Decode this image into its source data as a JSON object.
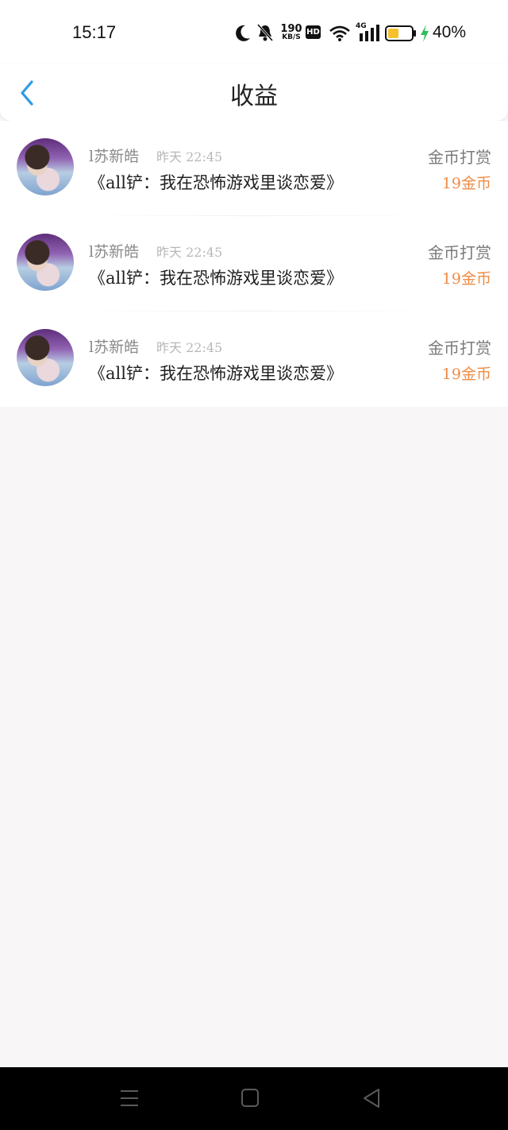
{
  "status_bar": {
    "time": "15:17",
    "network_speed_top": "190",
    "network_speed_bottom": "KB/S",
    "hd_label": "HD",
    "signal_label": "4G",
    "battery_percent": "40%",
    "icons": [
      "moon-icon",
      "bell-off-icon",
      "hd-icon",
      "wifi-icon",
      "signal-icon",
      "battery-icon",
      "charging-icon"
    ]
  },
  "header": {
    "title": "收益",
    "back_icon": "chevron-left-icon",
    "accent_color": "#2e9be6"
  },
  "entries": [
    {
      "name": "l苏新皓",
      "date": "昨天 22:45",
      "book": "《all铲：我在恐怖游戏里谈恋爱》",
      "type": "金币打赏",
      "amount_num": "19",
      "amount_unit": "金币"
    },
    {
      "name": "l苏新皓",
      "date": "昨天 22:45",
      "book": "《all铲：我在恐怖游戏里谈恋爱》",
      "type": "金币打赏",
      "amount_num": "19",
      "amount_unit": "金币"
    },
    {
      "name": "l苏新皓",
      "date": "昨天 22:45",
      "book": "《all铲：我在恐怖游戏里谈恋爱》",
      "type": "金币打赏",
      "amount_num": "19",
      "amount_unit": "金币"
    }
  ],
  "colors": {
    "amount": "#ef8b45",
    "background": "#f8f6f7"
  },
  "nav_bar": {
    "icons": [
      "menu-icon",
      "home-icon",
      "back-triangle-icon"
    ]
  }
}
